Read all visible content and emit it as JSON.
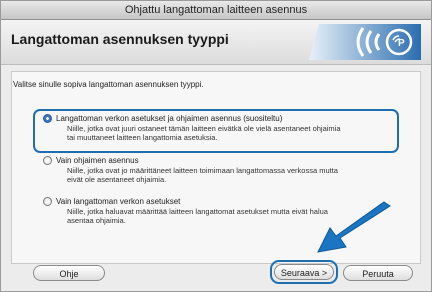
{
  "window": {
    "title": "Ohjattu langattoman laitteen asennus"
  },
  "header": {
    "heading": "Langattoman asennuksen tyyppi",
    "logo_icon": "wifi-signal-icon"
  },
  "main": {
    "instruction": "Valitse sinulle sopiva langattoman asennuksen tyyppi.",
    "options": [
      {
        "title": "Langattoman verkon asetukset ja ohjaimen asennus (suositeltu)",
        "desc_lines": [
          "Niille, jotka ovat juuri ostaneet tämän laitteen eivätkä ole vielä asentaneet ohjaimia",
          "tai muuttaneet laitteen langattomia asetuksia."
        ],
        "selected": true
      },
      {
        "title": "Vain ohjaimen asennus",
        "desc_lines": [
          "Niille, jotka ovat jo määrittäneet laitteen toimimaan langattomassa verkossa mutta",
          "eivät ole asentaneet ohjaimia."
        ],
        "selected": false
      },
      {
        "title": "Vain langattoman verkon asetukset",
        "desc_lines": [
          "Niille, jotka haluavat määrittää laitteen langattomat asetukset mutta eivät halua",
          "asentaa ohjaimia."
        ],
        "selected": false
      }
    ]
  },
  "footer": {
    "help_label": "Ohje",
    "next_label": "Seuraava >",
    "cancel_label": "Peruuta"
  },
  "colors": {
    "highlight": "#1f6fb0",
    "arrow": "#1a76c2"
  }
}
